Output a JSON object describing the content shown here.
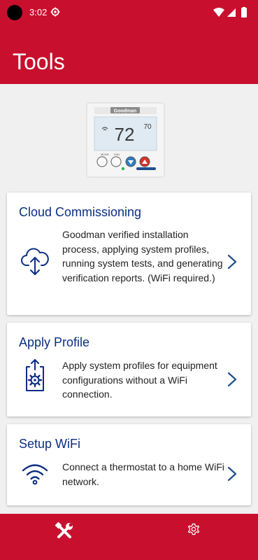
{
  "status_bar": {
    "time": "3:02"
  },
  "header": {
    "title": "Tools"
  },
  "thermostat_image": {
    "brand": "Goodman",
    "temperature": "72",
    "setpoint": "70",
    "mode_label": "MODE",
    "fan_label": "FAN"
  },
  "cards": [
    {
      "title": "Cloud Commissioning",
      "description": "Goodman verified installation process, applying system profiles, running system tests, and generating verification reports. (WiFi required.)",
      "icon": "cloud-upload-icon"
    },
    {
      "title": "Apply Profile",
      "description": "Apply system profiles for equipment configurations without a WiFi connection.",
      "icon": "apply-profile-icon"
    },
    {
      "title": "Setup WiFi",
      "description": "Connect a thermostat to a home WiFi network.",
      "icon": "wifi-icon"
    }
  ],
  "bottom_nav": [
    {
      "name": "tools",
      "icon": "tools-icon",
      "selected": true
    },
    {
      "name": "settings",
      "icon": "settings-icon",
      "selected": false
    }
  ],
  "colors": {
    "brand_red": "#c8102e",
    "title_blue": "#0b2e83",
    "icon_blue": "#0b2e83",
    "background": "#f0f0f0"
  }
}
